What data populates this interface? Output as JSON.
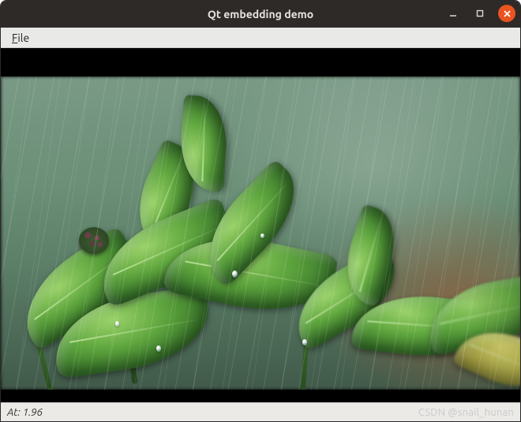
{
  "window": {
    "title": "Qt embedding demo"
  },
  "menubar": {
    "file_label": "File",
    "file_mnemonic": "F"
  },
  "status": {
    "label_prefix": "At: ",
    "value": "1.96"
  },
  "watermark": {
    "text": "CSDN @snail_hunan"
  },
  "image": {
    "description": "green-leaves-rain-photo"
  }
}
